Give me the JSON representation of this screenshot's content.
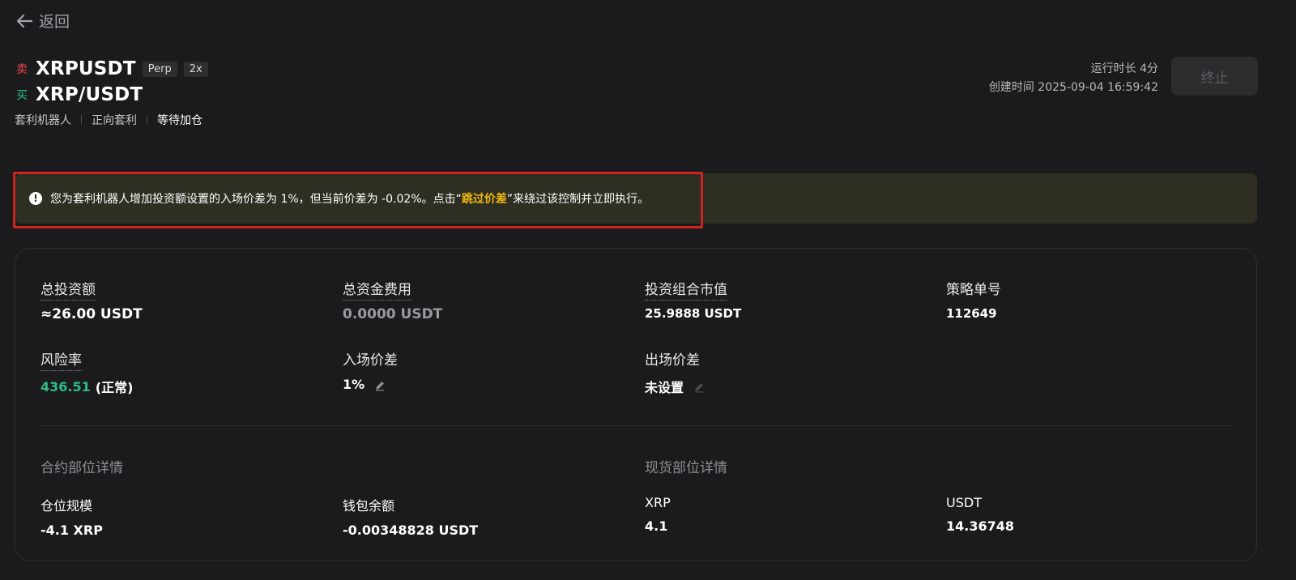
{
  "nav": {
    "back_label": "返回"
  },
  "header": {
    "sell_tag": "卖",
    "sell_symbol": "XRPUSDT",
    "chip_perp": "Perp",
    "chip_leverage": "2x",
    "buy_tag": "买",
    "buy_symbol": "XRP/USDT",
    "meta": [
      "套利机器人",
      "正向套利",
      "等待加仓"
    ],
    "run_time": "运行时长 4分",
    "created_time": "创建时间 2025-09-04 16:59:42",
    "stop_label": "终止"
  },
  "alert": {
    "text_before": "您为套利机器人增加投资额设置的入场价差为 1%，但当前价差为 -0.02%。点击“",
    "highlight": "跳过价差",
    "text_after": "”来绕过该控制并立即执行。"
  },
  "summary": {
    "total_invest_label": "总投资额",
    "total_invest_value": "≈26.00 USDT",
    "total_fee_label": "总资金费用",
    "total_fee_value": "0.0000 USDT",
    "portfolio_label": "投资组合市值",
    "portfolio_value": "25.9888 USDT",
    "strategy_id_label": "策略单号",
    "strategy_id_value": "112649",
    "risk_label": "风险率",
    "risk_value": "436.51",
    "risk_status": "(正常)",
    "entry_spread_label": "入场价差",
    "entry_spread_value": "1%",
    "exit_spread_label": "出场价差",
    "exit_spread_value": "未设置"
  },
  "futures": {
    "title": "合约部位详情",
    "position_label": "仓位规模",
    "position_value": "-4.1 XRP",
    "wallet_label": "钱包余额",
    "wallet_value": "-0.00348828 USDT"
  },
  "spot": {
    "title": "现货部位详情",
    "xrp_label": "XRP",
    "xrp_value": "4.1",
    "usdt_label": "USDT",
    "usdt_value": "14.36748"
  },
  "colors": {
    "sell": "#f0454e",
    "buy": "#2dbd85",
    "highlight": "#f0b90b",
    "alert_bg": "#2f2e23"
  },
  "icons": {
    "back": "arrow-left-icon",
    "alert": "exclamation-icon",
    "edit": "pencil-icon"
  }
}
